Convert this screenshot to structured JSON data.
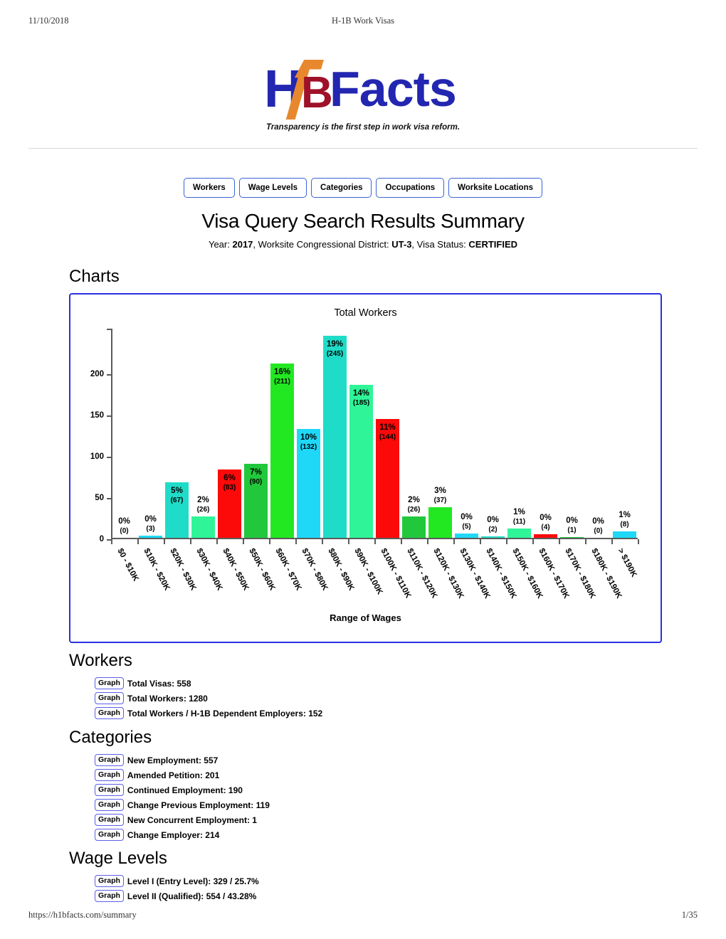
{
  "print_header": {
    "date": "11/10/2018",
    "title": "H-1B Work Visas"
  },
  "print_footer": {
    "url": "https://h1bfacts.com/summary",
    "page": "1/35"
  },
  "logo": {
    "h": "H",
    "b": "B",
    "facts": "Facts",
    "tagline": "Transparency is the first step in work visa reform."
  },
  "nav": {
    "items": [
      {
        "label": "Workers"
      },
      {
        "label": "Wage Levels"
      },
      {
        "label": "Categories"
      },
      {
        "label": "Occupations"
      },
      {
        "label": "Worksite Locations"
      }
    ]
  },
  "header": {
    "title": "Visa Query Search Results Summary",
    "sub_year_label": "Year:",
    "sub_year_value": "2017",
    "sub_district_label": ", Worksite Congressional District:",
    "sub_district_value": "UT-3",
    "sub_status_label": ", Visa Status:",
    "sub_status_value": "CERTIFIED"
  },
  "sections": {
    "charts_heading": "Charts",
    "workers_heading": "Workers",
    "categories_heading": "Categories",
    "wage_levels_heading": "Wage Levels"
  },
  "graph_button_label": "Graph",
  "workers_items": [
    {
      "label": "Total Visas: 558"
    },
    {
      "label": "Total Workers: 1280"
    },
    {
      "label": "Total Workers / H-1B Dependent Employers: 152"
    }
  ],
  "categories_items": [
    {
      "label": "New Employment: 557"
    },
    {
      "label": "Amended Petition: 201"
    },
    {
      "label": "Continued Employment: 190"
    },
    {
      "label": "Change Previous Employment: 119"
    },
    {
      "label": "New Concurrent Employment: 1"
    },
    {
      "label": "Change Employer: 214"
    }
  ],
  "wage_levels_items": [
    {
      "label": "Level I (Entry Level): 329 / 25.7%"
    },
    {
      "label": "Level II (Qualified): 554 / 43.28%"
    }
  ],
  "chart_data": {
    "type": "bar",
    "title": "Total Workers",
    "xlabel": "Range of Wages",
    "ylabel": "",
    "ylim": [
      0,
      250
    ],
    "yticks": [
      0,
      50,
      100,
      150,
      200
    ],
    "grid": false,
    "legend": null,
    "categories": [
      "$0 - $10K",
      "$10K - $20K",
      "$20K - $30K",
      "$30K - $40K",
      "$40K - $50K",
      "$50K - $60K",
      "$60K - $70K",
      "$70K - $80K",
      "$80K - $90K",
      "$90K - $100K",
      "$100K - $110K",
      "$110K - $120K",
      "$120K - $130K",
      "$130K - $140K",
      "$140K - $150K",
      "$150K - $160K",
      "$160K - $170K",
      "$170K - $180K",
      "$180K - $190K",
      "> $190K"
    ],
    "values": [
      0,
      3,
      67,
      26,
      83,
      90,
      211,
      132,
      245,
      185,
      144,
      26,
      37,
      5,
      2,
      11,
      4,
      1,
      0,
      8
    ],
    "percent_labels": [
      "0%",
      "0%",
      "5%",
      "2%",
      "6%",
      "7%",
      "16%",
      "10%",
      "19%",
      "14%",
      "11%",
      "2%",
      "3%",
      "0%",
      "0%",
      "1%",
      "0%",
      "0%",
      "0%",
      "1%"
    ],
    "count_labels": [
      "(0)",
      "(3)",
      "(67)",
      "(26)",
      "(83)",
      "(90)",
      "(211)",
      "(132)",
      "(245)",
      "(185)",
      "(144)",
      "(26)",
      "(37)",
      "(5)",
      "(2)",
      "(11)",
      "(4)",
      "(1)",
      "(0)",
      "(8)"
    ],
    "colors": [
      "#1FD8F8",
      "#1FD8F8",
      "#1FDCC8",
      "#2FF598",
      "#FC0909",
      "#22C83C",
      "#22E822",
      "#1FD8F8",
      "#1FDCC8",
      "#2FF598",
      "#FC0909",
      "#22C83C",
      "#22E822",
      "#1FD8F8",
      "#1FDCC8",
      "#2FF598",
      "#FC0909",
      "#22C83C",
      "#22E822",
      "#1FD8F8"
    ]
  },
  "colors": {
    "accent_blue": "#2a30e0",
    "logo_blue": "#2326b0",
    "logo_orange": "#e8882e",
    "logo_red": "#9e1128"
  }
}
